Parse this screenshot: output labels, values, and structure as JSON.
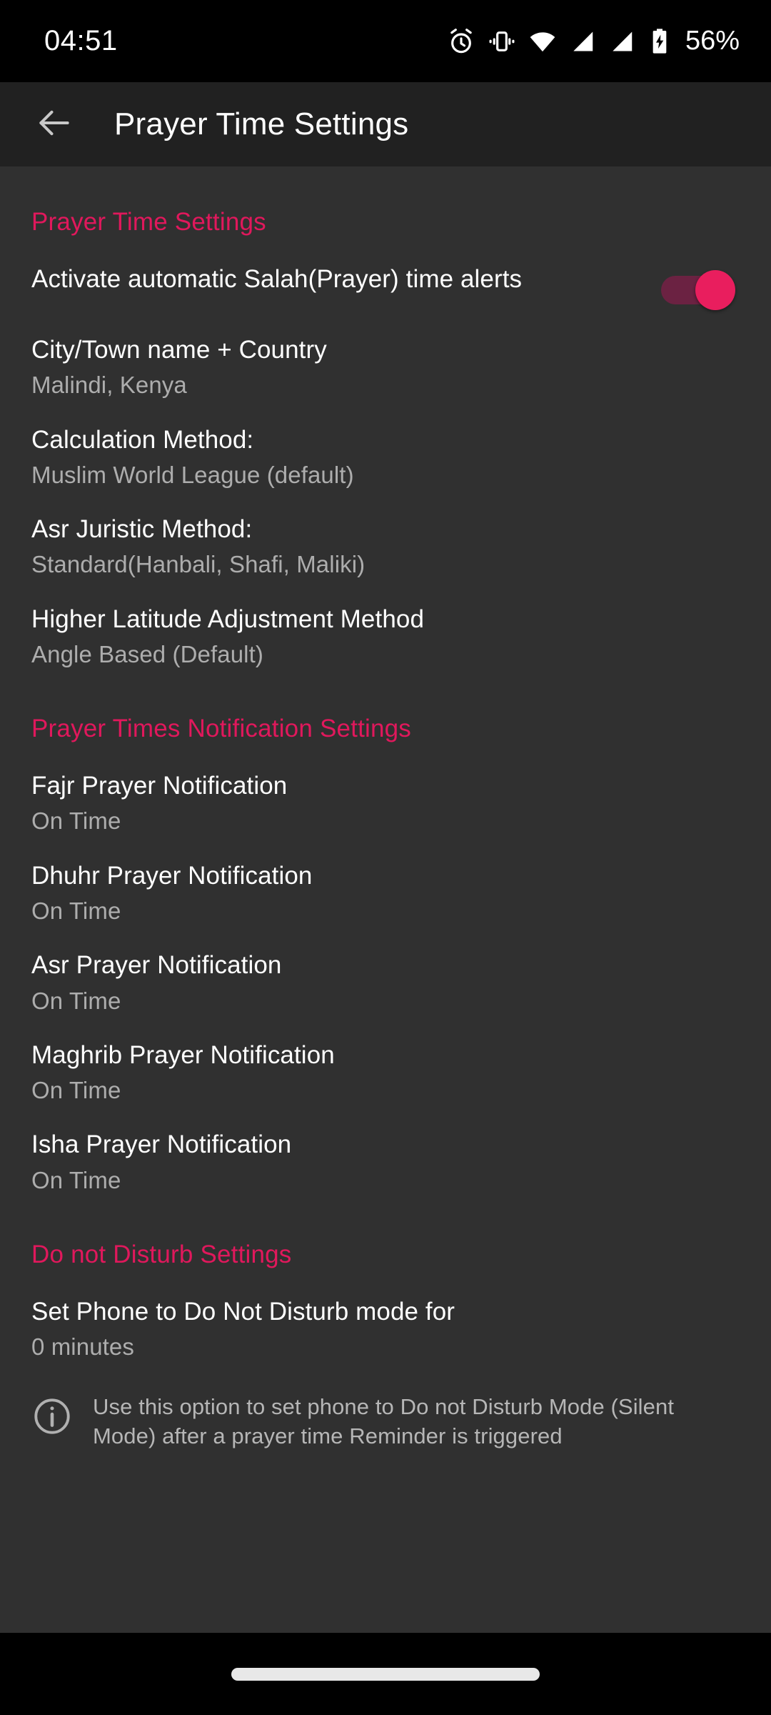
{
  "status_bar": {
    "time": "04:51",
    "battery_percent": "56%",
    "icons": [
      "alarm-icon",
      "vibrate-icon",
      "wifi-icon",
      "signal-icon-1",
      "signal-icon-2",
      "battery-charging-icon"
    ]
  },
  "app_bar": {
    "back_label": "back-arrow",
    "title": "Prayer Time Settings"
  },
  "sections": {
    "prayer_time": {
      "header": "Prayer Time Settings",
      "activate": {
        "title": "Activate automatic Salah(Prayer) time alerts",
        "toggle_state": "on"
      },
      "city": {
        "title": "City/Town name + Country",
        "value": "Malindi, Kenya"
      },
      "calculation": {
        "title": "Calculation Method:",
        "value": "Muslim World League (default)"
      },
      "asr": {
        "title": "Asr Juristic Method:",
        "value": "Standard(Hanbali, Shafi, Maliki)"
      },
      "latitude": {
        "title": "Higher Latitude Adjustment Method",
        "value": "Angle Based (Default)"
      }
    },
    "notifications": {
      "header": "Prayer Times Notification Settings",
      "items": [
        {
          "title": "Fajr Prayer Notification",
          "value": "On Time"
        },
        {
          "title": "Dhuhr Prayer Notification",
          "value": "On Time"
        },
        {
          "title": "Asr Prayer Notification",
          "value": "On Time"
        },
        {
          "title": "Maghrib Prayer Notification",
          "value": "On Time"
        },
        {
          "title": "Isha Prayer Notification",
          "value": "On Time"
        }
      ]
    },
    "dnd": {
      "header": "Do not Disturb Settings",
      "set_phone": {
        "title": "Set Phone to Do Not Disturb mode for",
        "value": "0 minutes"
      },
      "info": "Use this option to set phone to Do not Disturb Mode (Silent Mode) after a prayer time Reminder is triggered"
    }
  },
  "nav_bar": {
    "pill_label": "home-gesture-pill"
  },
  "colors": {
    "accent": "#e0185c",
    "toggle_thumb": "#e91e5e",
    "toggle_track": "#6b2242",
    "background": "#303030",
    "appbar_background": "#212121",
    "primary_text": "#ffffff",
    "secondary_text": "#adadad"
  }
}
